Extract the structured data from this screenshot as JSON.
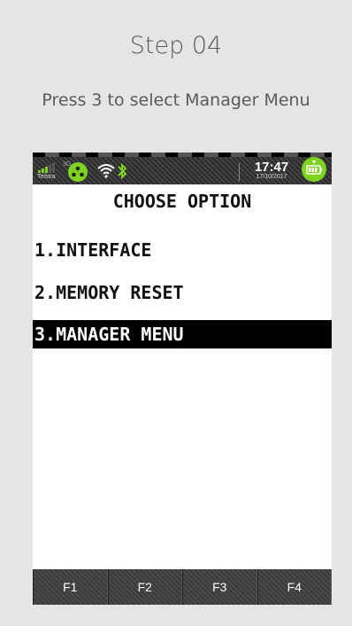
{
  "step": {
    "title": "Step 04",
    "description": "Press 3 to select Manager Menu"
  },
  "status_bar": {
    "carrier": "Telstra",
    "network": "3G",
    "time": "17:47",
    "date": "17/10/2017",
    "icons": [
      "signal-icon",
      "sim-icon",
      "wifi-icon",
      "bluetooth-icon",
      "battery-icon"
    ],
    "accent_color": "#7ed321"
  },
  "menu": {
    "title": "CHOOSE OPTION",
    "items": [
      {
        "label": "1.INTERFACE",
        "selected": false
      },
      {
        "label": "2.MEMORY RESET",
        "selected": false
      },
      {
        "label": "3.MANAGER MENU",
        "selected": true
      }
    ]
  },
  "function_keys": [
    "F1",
    "F2",
    "F3",
    "F4"
  ]
}
